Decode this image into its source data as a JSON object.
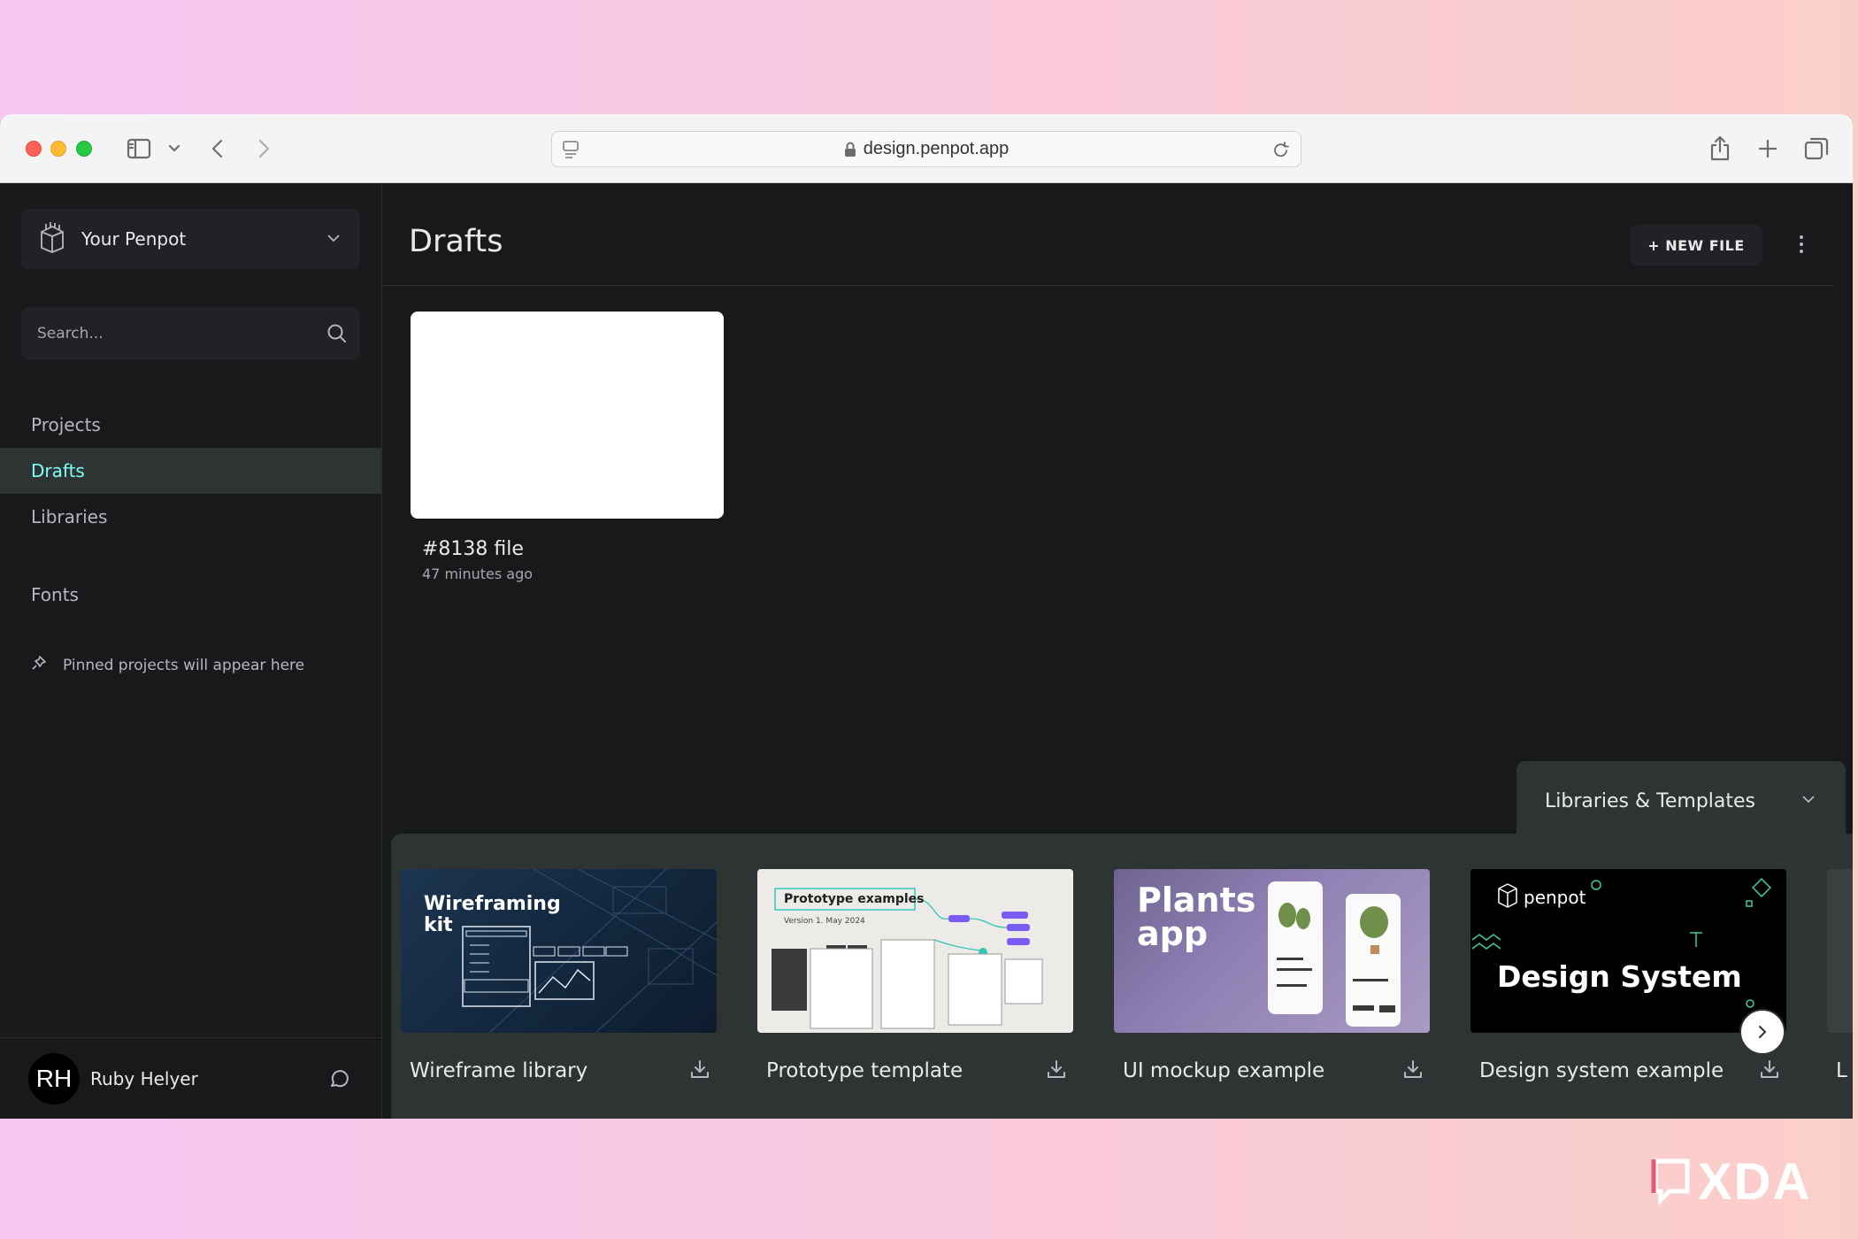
{
  "browser": {
    "url": "design.penpot.app"
  },
  "sidebar": {
    "team_name": "Your Penpot",
    "search_placeholder": "Search...",
    "nav": [
      {
        "label": "Projects",
        "active": false
      },
      {
        "label": "Drafts",
        "active": true
      },
      {
        "label": "Libraries",
        "active": false
      },
      {
        "label": "Fonts",
        "active": false
      }
    ],
    "pinned_text": "Pinned projects will appear here",
    "profile": {
      "initials": "RH",
      "name": "Ruby Helyer"
    }
  },
  "main": {
    "title": "Drafts",
    "new_file_label": "+ NEW FILE",
    "files": [
      {
        "name": "#8138 file",
        "time": "47 minutes ago"
      }
    ]
  },
  "templates": {
    "tab_label": "Libraries & Templates",
    "items": [
      {
        "name": "Wireframe library",
        "thumb_title": "Wireframing kit"
      },
      {
        "name": "Prototype template",
        "thumb_title": "Prototype examples",
        "thumb_sub": "Version 1. May 2024"
      },
      {
        "name": "UI mockup example",
        "thumb_title": "Plants app"
      },
      {
        "name": "Design system example",
        "thumb_brand": "penpot",
        "thumb_title": "Design System"
      }
    ],
    "partial_next_letter": "L"
  },
  "watermark": {
    "text": "XDA"
  },
  "colors": {
    "accent": "#7efff5",
    "background": "#18191b",
    "panel": "#2e3434"
  }
}
